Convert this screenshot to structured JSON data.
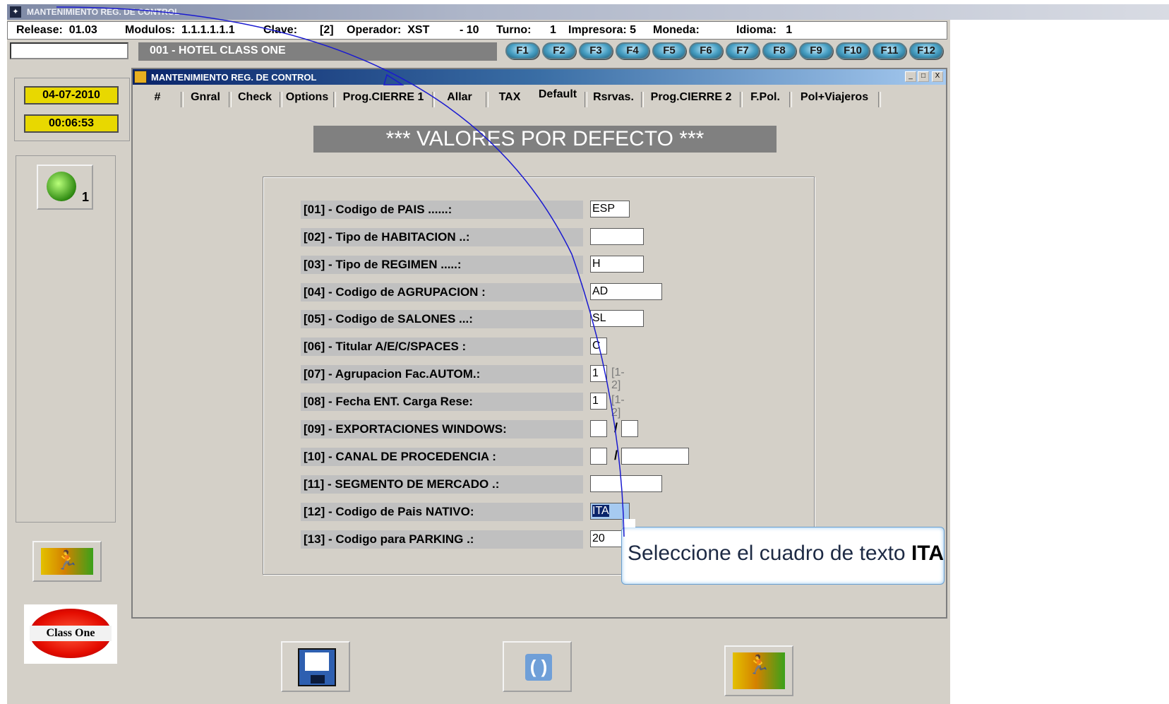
{
  "app": {
    "title": "MANTENIMIENTO REG. DE CONTROL",
    "info": {
      "release": "Release:  01.03",
      "modulos": "Modulos:  1.1.1.1.1.1",
      "clave": "Clave:",
      "clave_val": "[2]",
      "operador": "Operador:  XST",
      "menos10": "- 10",
      "turno": "Turno:",
      "turno_val": "1",
      "impresora": "Impresora: 5",
      "moneda": "Moneda:",
      "idioma": "Idioma:   1"
    },
    "hotel": "001 - HOTEL CLASS ONE",
    "fkeys": [
      "F1",
      "F2",
      "F3",
      "F4",
      "F5",
      "F6",
      "F7",
      "F8",
      "F9",
      "F10",
      "F11",
      "F12"
    ],
    "date": "04-07-2010",
    "time": "00:06:53",
    "tools_badge": "1",
    "logo_text": "Class One"
  },
  "window": {
    "title": "MANTENIMIENTO REG. DE CONTROL",
    "controls": [
      "_",
      "□",
      "X"
    ],
    "tabs": [
      "#",
      "Gnral",
      "Check",
      "Options",
      "Prog.CIERRE 1",
      "Allar",
      "TAX",
      "Default",
      "Rsrvas.",
      "Prog.CIERRE 2",
      "F.Pol.",
      "Pol+Viajeros"
    ],
    "active_tab": "Default",
    "banner": "***  VALORES POR DEFECTO ***",
    "fields": [
      {
        "label": "[01] - Codigo de PAIS ......:",
        "value": "ESP"
      },
      {
        "label": "[02] - Tipo de HABITACION ..:",
        "value": ""
      },
      {
        "label": "[03] - Tipo de REGIMEN .....:",
        "value": "H"
      },
      {
        "label": "[04] - Codigo de AGRUPACION :",
        "value": "AD"
      },
      {
        "label": "[05] - Codigo de SALONES ...:",
        "value": "SL"
      },
      {
        "label": "[06] - Titular A/E/C/SPACES :",
        "value": "C"
      },
      {
        "label": "[07] - Agrupacion Fac.AUTOM.:",
        "value": "1",
        "hint": "[1-2]"
      },
      {
        "label": "[08] - Fecha ENT. Carga Rese:",
        "value": "1",
        "hint": "[1-2]"
      },
      {
        "label": "[09] - EXPORTACIONES WINDOWS:",
        "value": "",
        "value2": "",
        "sep": "/"
      },
      {
        "label": "[10] - CANAL DE PROCEDENCIA :",
        "value": "",
        "value2": "",
        "sep": "/"
      },
      {
        "label": "[11] - SEGMENTO DE MERCADO .:",
        "value": ""
      },
      {
        "label": "[12] - Codigo de Pais NATIVO:",
        "value": "ITA"
      },
      {
        "label": "[13] - Codigo para PARKING .:",
        "value": "20"
      }
    ]
  },
  "tooltip": {
    "text": "Seleccione el cuadro de texto ",
    "bold": "ITA"
  },
  "colors": {
    "window_bg": "#d4d0c8",
    "titlebar": "#0a246a",
    "date_bg": "#e8d800",
    "banner_bg": "#808080",
    "arrow": "#1a1ad0",
    "selection": "#0a246a"
  }
}
